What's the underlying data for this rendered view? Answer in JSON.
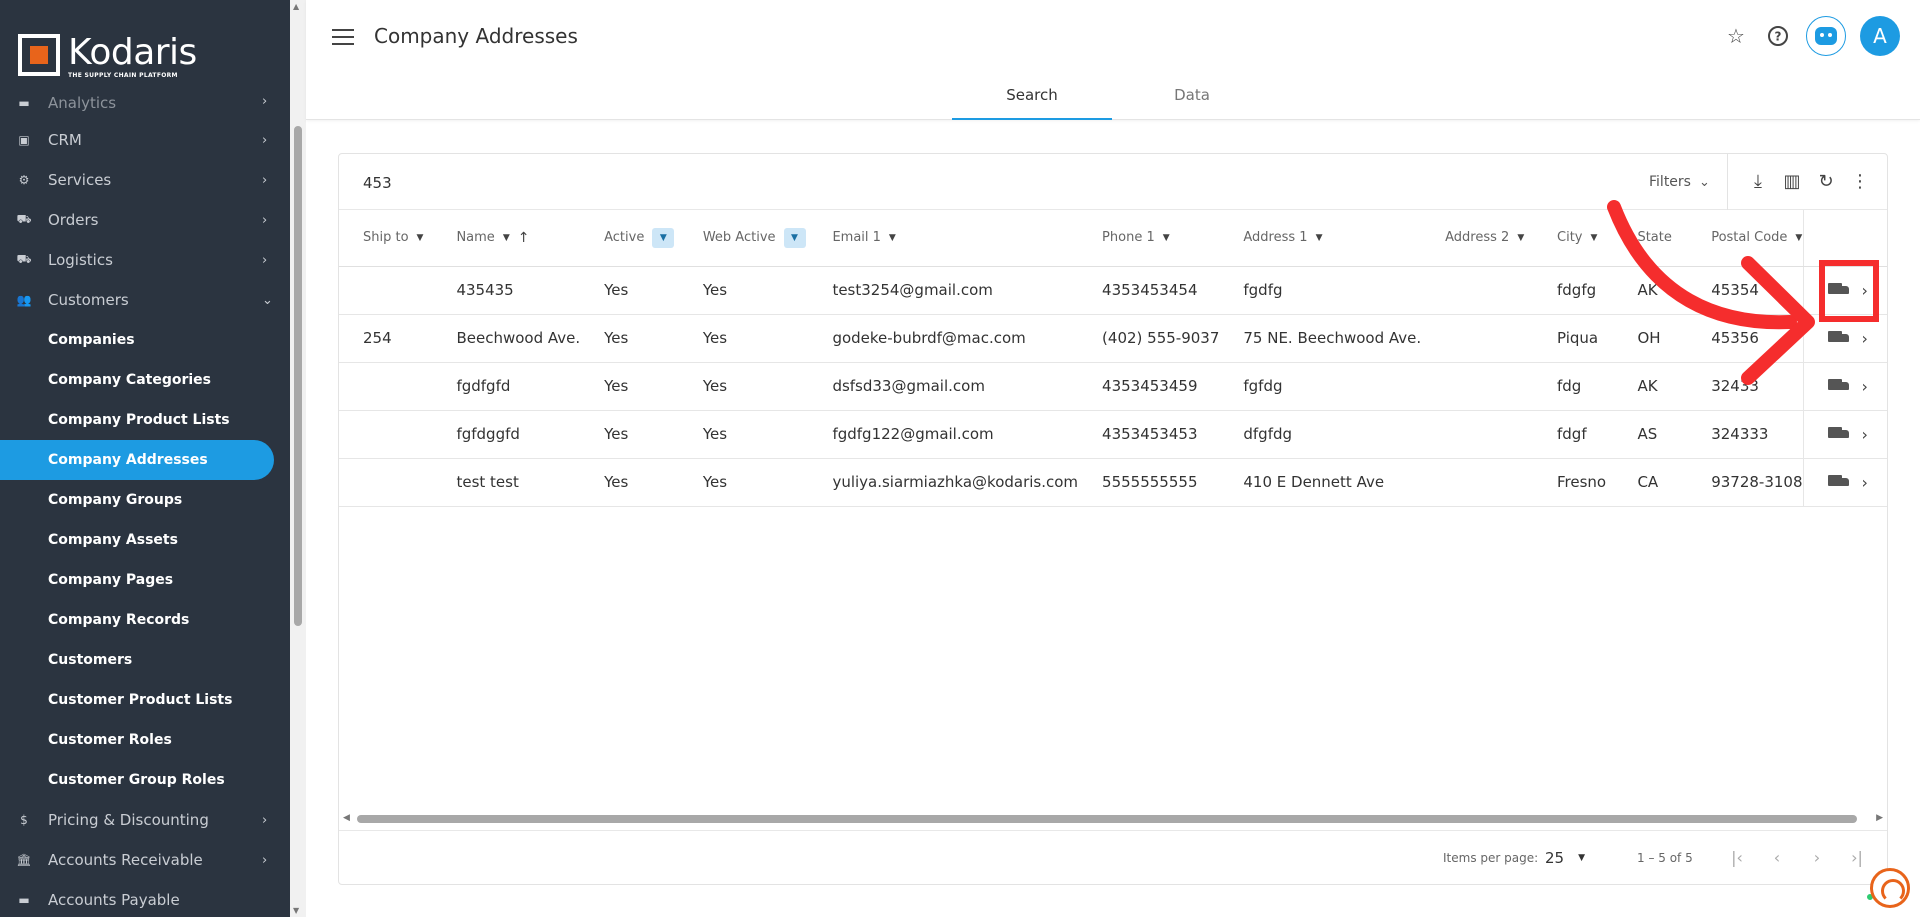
{
  "brand": {
    "name": "Kodaris",
    "tagline": "THE SUPPLY CHAIN PLATFORM"
  },
  "colors": {
    "accent": "#1d9be2",
    "sidebar": "#2b3440",
    "brand_orange": "#e8641b",
    "annotation_red": "#f52d2d"
  },
  "sidebar": {
    "partial_top": "Analytics",
    "sections": [
      {
        "label": "CRM",
        "icon": "crm-icon",
        "expanded": false
      },
      {
        "label": "Services",
        "icon": "services-icon",
        "expanded": false
      },
      {
        "label": "Orders",
        "icon": "orders-icon",
        "expanded": false
      },
      {
        "label": "Logistics",
        "icon": "logistics-icon",
        "expanded": false
      },
      {
        "label": "Customers",
        "icon": "customers-icon",
        "expanded": true
      }
    ],
    "sub_items": [
      {
        "label": "Companies"
      },
      {
        "label": "Company Categories"
      },
      {
        "label": "Company Product Lists"
      },
      {
        "label": "Company Addresses",
        "active": true
      },
      {
        "label": "Company Groups"
      },
      {
        "label": "Company Assets"
      },
      {
        "label": "Company Pages"
      },
      {
        "label": "Company Records"
      },
      {
        "label": "Customers"
      },
      {
        "label": "Customer Product Lists"
      },
      {
        "label": "Customer Roles"
      },
      {
        "label": "Customer Group Roles"
      }
    ],
    "after": [
      {
        "label": "Pricing & Discounting",
        "icon": "dollar-icon"
      },
      {
        "label": "Accounts Receivable",
        "icon": "bank-icon"
      }
    ],
    "partial_bottom": "Accounts Payable"
  },
  "header": {
    "title": "Company Addresses",
    "avatar_initial": "A",
    "tabs": [
      {
        "label": "Search",
        "active": true
      },
      {
        "label": "Data",
        "active": false
      }
    ]
  },
  "toolbar": {
    "count": "453",
    "filters_label": "Filters"
  },
  "table": {
    "columns": [
      {
        "label": "Ship to",
        "filter": "caret"
      },
      {
        "label": "Name",
        "filter": "caret",
        "sort": "asc"
      },
      {
        "label": "Active",
        "filter": "active-caret"
      },
      {
        "label": "Web Active",
        "filter": "active-caret"
      },
      {
        "label": "Email 1",
        "filter": "caret"
      },
      {
        "label": "Phone 1",
        "filter": "caret"
      },
      {
        "label": "Address 1",
        "filter": "caret"
      },
      {
        "label": "Address 2",
        "filter": "caret"
      },
      {
        "label": "City",
        "filter": "caret"
      },
      {
        "label": "State",
        "filter": "none"
      },
      {
        "label": "Postal Code",
        "filter": "caret"
      }
    ],
    "rows": [
      [
        "",
        "435435",
        "Yes",
        "Yes",
        "test3254@gmail.com",
        "4353453454",
        "fgdfg",
        "",
        "fdgfg",
        "AK",
        "45354"
      ],
      [
        "254",
        "Beechwood Ave.",
        "Yes",
        "Yes",
        "godeke-bubrdf@mac.com",
        "(402) 555-9037",
        "75 NE. Beechwood Ave.",
        "",
        "Piqua",
        "OH",
        "45356"
      ],
      [
        "",
        "fgdfgfd",
        "Yes",
        "Yes",
        "dsfsd33@gmail.com",
        "4353453459",
        "fgfdg",
        "",
        "fdg",
        "AK",
        "32433"
      ],
      [
        "",
        "fgfdggfd",
        "Yes",
        "Yes",
        "fgdfg122@gmail.com",
        "4353453453",
        "dfgfdg",
        "",
        "fdgf",
        "AS",
        "324333"
      ],
      [
        "",
        "test test",
        "Yes",
        "Yes",
        "yuliya.siarmiazhka@kodaris.com",
        "5555555555",
        "410 E Dennett Ave",
        "",
        "Fresno",
        "CA",
        "93728-3108"
      ]
    ]
  },
  "paginator": {
    "items_per_page_label": "Items per page:",
    "items_per_page": "25",
    "range": "1 – 5 of 5"
  }
}
